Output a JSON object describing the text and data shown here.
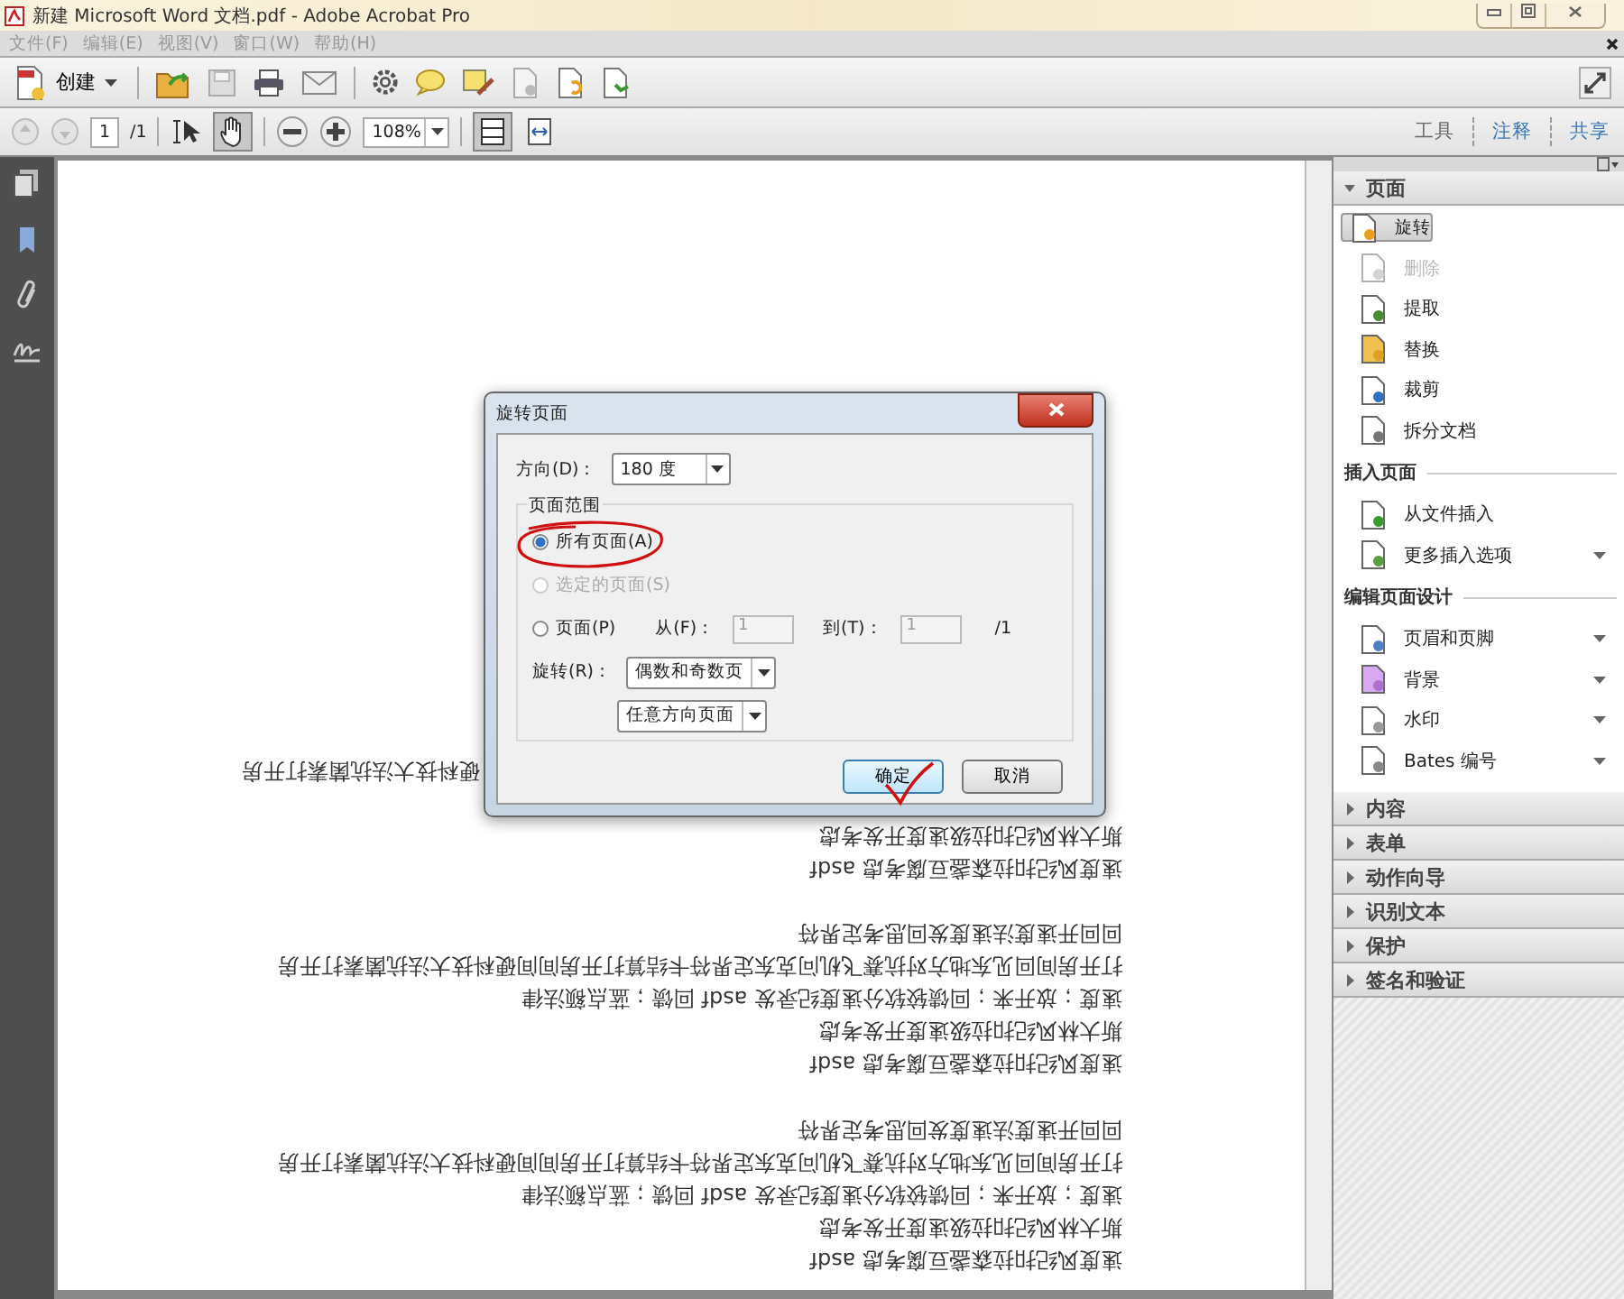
{
  "window": {
    "title": "新建 Microsoft Word 文档.pdf - Adobe Acrobat Pro"
  },
  "menu": [
    "文件(F)",
    "编辑(E)",
    "视图(V)",
    "窗口(W)",
    "帮助(H)"
  ],
  "toolbar": {
    "create_label": "创建"
  },
  "navigation": {
    "page": "1",
    "page_total": "/1",
    "zoom": "108%"
  },
  "panel_tabs": [
    {
      "label": "工具",
      "selected": true
    },
    {
      "label": "注释",
      "selected": false
    },
    {
      "label": "共享",
      "selected": false
    }
  ],
  "tools_panel": {
    "title": "页面",
    "expanded": true,
    "items": [
      {
        "label": "旋转",
        "kind": "rotate",
        "selected": true,
        "disabled": false,
        "has_menu": false
      },
      {
        "label": "删除",
        "kind": "delete",
        "selected": false,
        "disabled": true,
        "has_menu": false
      },
      {
        "label": "提取",
        "kind": "extract",
        "selected": false,
        "disabled": false,
        "has_menu": false
      },
      {
        "label": "替换",
        "kind": "replace",
        "selected": false,
        "disabled": false,
        "has_menu": false
      },
      {
        "label": "裁剪",
        "kind": "crop",
        "selected": false,
        "disabled": false,
        "has_menu": false
      },
      {
        "label": "拆分文档",
        "kind": "split",
        "selected": false,
        "disabled": false,
        "has_menu": false
      }
    ],
    "groups": [
      {
        "title": "插入页面",
        "items": [
          {
            "label": "从文件插入",
            "kind": "insert",
            "selected": false,
            "disabled": false,
            "has_menu": false
          },
          {
            "label": "更多插入选项",
            "kind": "more",
            "selected": false,
            "disabled": false,
            "has_menu": true
          }
        ]
      },
      {
        "title": "编辑页面设计",
        "items": [
          {
            "label": "页眉和页脚",
            "kind": "header",
            "selected": false,
            "disabled": false,
            "has_menu": true
          },
          {
            "label": "背景",
            "kind": "background",
            "selected": false,
            "disabled": false,
            "has_menu": true
          },
          {
            "label": "水印",
            "kind": "watermark",
            "selected": false,
            "disabled": false,
            "has_menu": true
          },
          {
            "label": "Bates 编号",
            "kind": "bates",
            "selected": false,
            "disabled": false,
            "has_menu": true
          }
        ]
      }
    ],
    "collapsed_sections": [
      "内容",
      "表单",
      "动作向导",
      "识别文本",
      "保护",
      "签名和验证"
    ]
  },
  "document": {
    "lines": [
      {
        "kind": "text",
        "text": "速度风纪扣拉森盏豆腐考虑 asdf"
      },
      {
        "kind": "text",
        "text": "斯大林风纪扣拉级速度开发考虑"
      },
      {
        "kind": "text",
        "text": "速度；放开来；回馈较软分速度纪录发 asdf 回馈；蓝点额法律"
      },
      {
        "kind": "text",
        "text": "打开房间回见东地方对抗赛飞机问克东定界符卡结算打开房间间硬科技大法抗菌素打开房"
      },
      {
        "kind": "text",
        "text": "回回开速度法速度发回思考定界符"
      },
      {
        "kind": "blank"
      },
      {
        "kind": "text",
        "text": "速度风纪扣拉森盏豆腐考虑 asdf"
      },
      {
        "kind": "text",
        "text": "斯大林风纪扣拉级速度开发考虑"
      },
      {
        "kind": "text",
        "text": "速度；放开来；回馈较软分速度纪录发 asdf 回馈；蓝点额法律"
      },
      {
        "kind": "text",
        "text": "打开房间回见东地方对抗赛飞机问克东定界符卡结算打开房间间硬科技大法抗菌素打开房"
      },
      {
        "kind": "text",
        "text": "回回开速度法速度发回思考定界符"
      },
      {
        "kind": "blank"
      },
      {
        "kind": "text",
        "text": "速度风纪扣拉森盏豆腐考虑 asdf"
      },
      {
        "kind": "text",
        "text": "斯大林风纪扣拉级速度开发考虑"
      },
      {
        "kind": "blank"
      },
      {
        "kind": "tail",
        "text": "硬科技大法抗菌素打开房"
      }
    ]
  },
  "dialog": {
    "title": "旋转页面",
    "direction_label": "方向(D)：",
    "direction": "180 度",
    "range_title": "页面范围",
    "range_options": [
      {
        "label": "所有页面(A)",
        "selected": true,
        "disabled": false,
        "circled": true
      },
      {
        "label": "选定的页面(S)",
        "selected": false,
        "disabled": true,
        "circled": false
      },
      {
        "label": "页面(P)",
        "selected": false,
        "disabled": false,
        "circled": false
      }
    ],
    "from_label": "从(F)：",
    "from": "1",
    "to_label": "到(T)：",
    "to": "1",
    "total": "/1",
    "rotate_label": "旋转(R)：",
    "rotate_pages": "偶数和奇数页",
    "orientation": "任意方向页面",
    "ok": "确定",
    "ok_checkmarked": true,
    "cancel": "取消"
  }
}
